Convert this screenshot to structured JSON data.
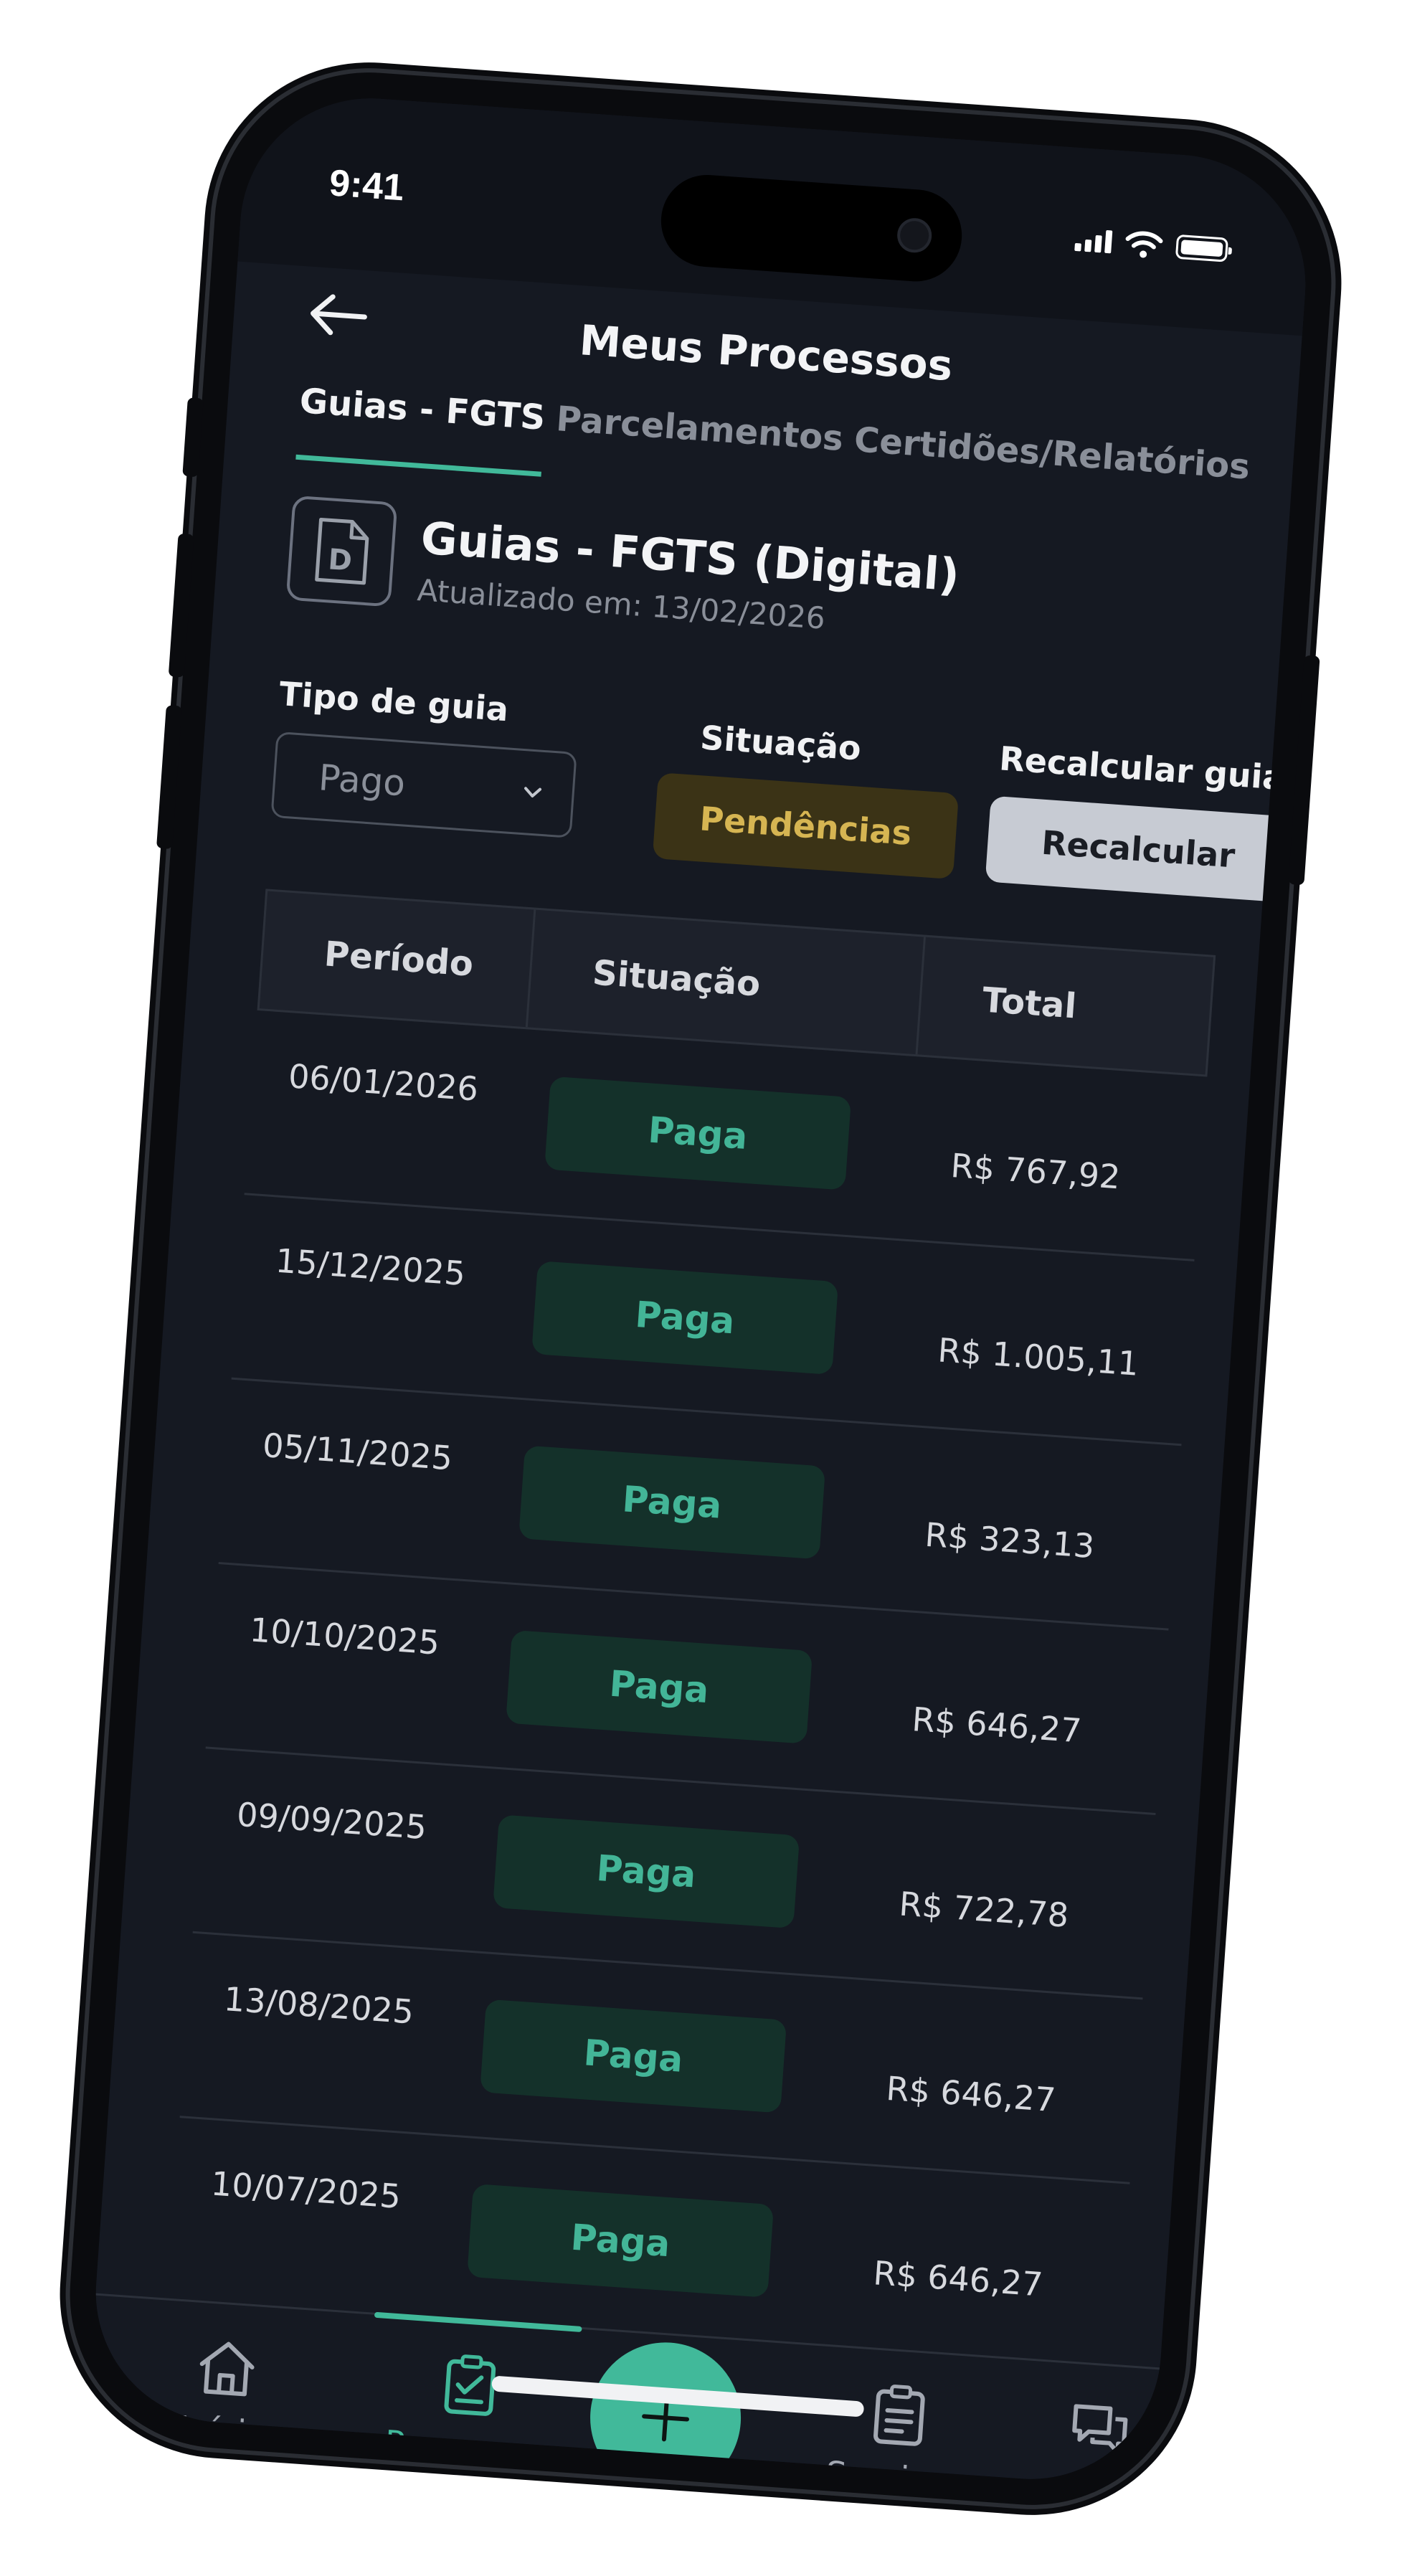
{
  "status_bar": {
    "time": "9:41"
  },
  "header": {
    "title": "Meus Processos"
  },
  "tabs": [
    {
      "label": "Guias - FGTS",
      "active": true
    },
    {
      "label": "Parcelamentos",
      "active": false
    },
    {
      "label": "Certidões/Relatórios",
      "active": false
    }
  ],
  "section": {
    "icon_letter": "D",
    "title": "Guias - FGTS (Digital)",
    "subtitle": "Atualizado em: 13/02/2026"
  },
  "filters": {
    "tipo_label": "Tipo de guia",
    "tipo_value": "Pago",
    "situacao_label": "Situação",
    "situacao_button": "Pendências",
    "recalcular_label": "Recalcular guias",
    "recalcular_button": "Recalcular"
  },
  "table": {
    "headers": [
      "Período",
      "Situação",
      "Total"
    ],
    "rows": [
      {
        "periodo": "06/01/2026",
        "situacao": "Paga",
        "total": "R$ 767,92"
      },
      {
        "periodo": "15/12/2025",
        "situacao": "Paga",
        "total": "R$ 1.005,11"
      },
      {
        "periodo": "05/11/2025",
        "situacao": "Paga",
        "total": "R$ 323,13"
      },
      {
        "periodo": "10/10/2025",
        "situacao": "Paga",
        "total": "R$ 646,27"
      },
      {
        "periodo": "09/09/2025",
        "situacao": "Paga",
        "total": "R$ 722,78"
      },
      {
        "periodo": "13/08/2025",
        "situacao": "Paga",
        "total": "R$ 646,27"
      },
      {
        "periodo": "10/07/2025",
        "situacao": "Paga",
        "total": "R$ 646,27"
      }
    ]
  },
  "bottom_nav": {
    "items": [
      {
        "label": "Início",
        "icon": "home-icon",
        "active": false
      },
      {
        "label": "Processos",
        "icon": "clipboard-check-icon",
        "active": true
      },
      {
        "label": "Serviços",
        "icon": "clipboard-list-icon",
        "active": false
      },
      {
        "label": "Chat",
        "icon": "chat-icon",
        "active": false
      }
    ],
    "fab_icon": "plus-icon"
  },
  "colors": {
    "accent": "#41b99a",
    "background": "#151922",
    "pending_text": "#d6b552",
    "pending_bg": "#3b3316",
    "paid_bg": "#14312a"
  }
}
